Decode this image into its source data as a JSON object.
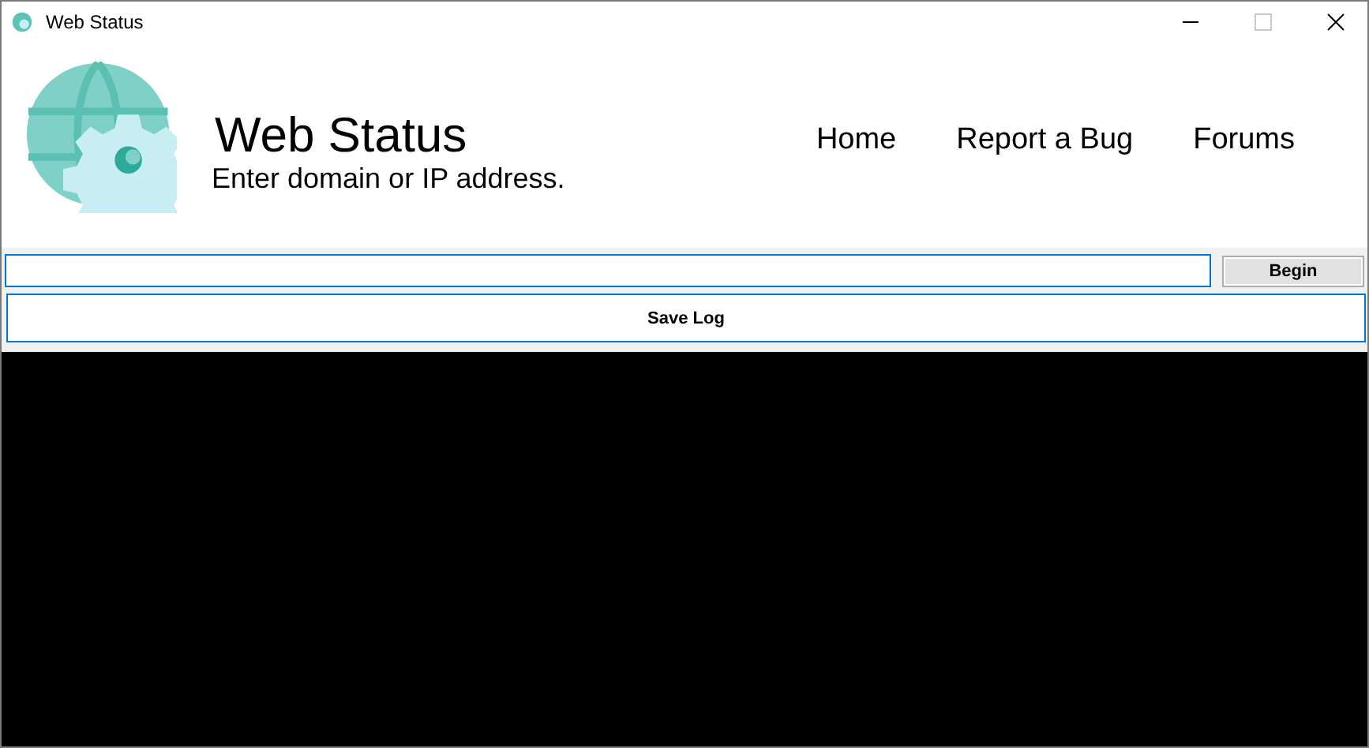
{
  "window": {
    "title": "Web Status",
    "maximize_disabled": true
  },
  "header": {
    "title": "Web Status",
    "subtitle": "Enter domain or IP address."
  },
  "nav": [
    {
      "label": "Home"
    },
    {
      "label": "Report a Bug"
    },
    {
      "label": "Forums"
    }
  ],
  "buttons": {
    "begin": "Begin",
    "save_log": "Save Log"
  }
}
